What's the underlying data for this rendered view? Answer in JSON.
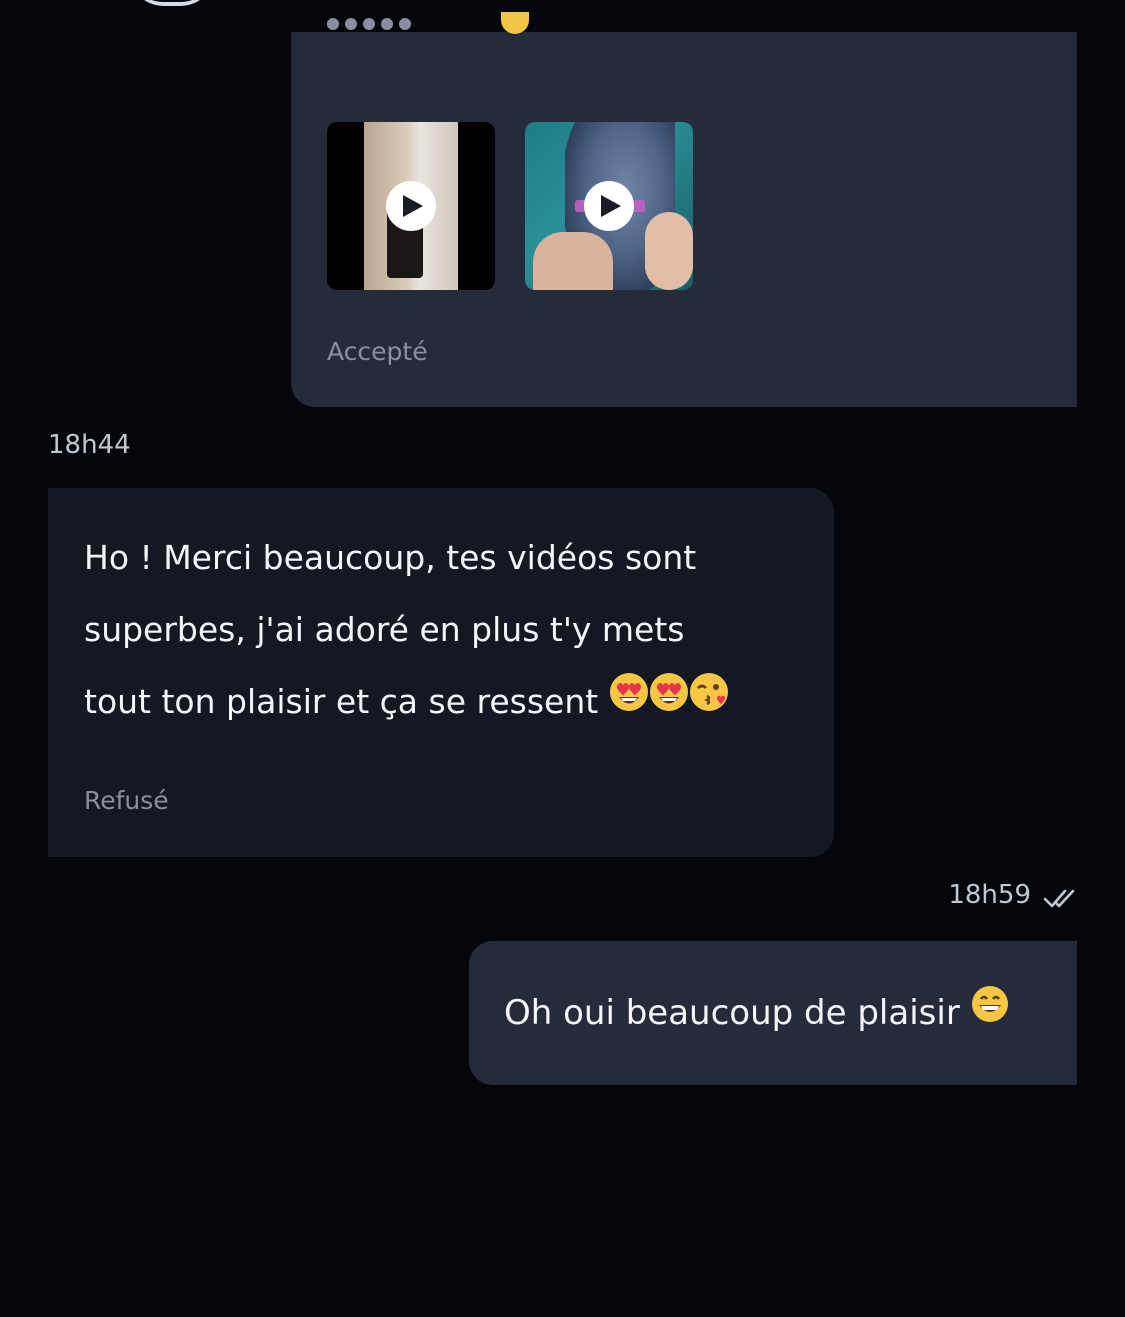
{
  "previous_message": {
    "status": "Accepté",
    "videos": [
      {
        "label": "video-thumbnail-1",
        "icon": "play-icon"
      },
      {
        "label": "video-thumbnail-2",
        "icon": "play-icon"
      }
    ]
  },
  "incoming_message": {
    "time": "18h44",
    "text": "Ho ! Merci beaucoup, tes vidéos sont superbes, j'ai adoré en plus t'y mets tout ton plaisir et ça se ressent",
    "line1": "Ho ! Merci beaucoup, tes vidéos sont",
    "line2": "superbes, j'ai adoré en plus t'y mets",
    "line3": "tout ton plaisir et ça se ressent",
    "emojis": [
      "heart-eyes-emoji",
      "heart-eyes-emoji",
      "kiss-emoji"
    ],
    "status": "Refusé"
  },
  "outgoing_message": {
    "time": "18h59",
    "read_icon": "double-check-icon",
    "text": "Oh oui beaucoup de plaisir",
    "emoji": "grin-emoji"
  },
  "colors": {
    "background": "#05060b",
    "outgoing_bubble": "#262b3b",
    "incoming_bubble": "#141823",
    "text": "#f4f5f8",
    "muted": "#8b8f9b"
  }
}
